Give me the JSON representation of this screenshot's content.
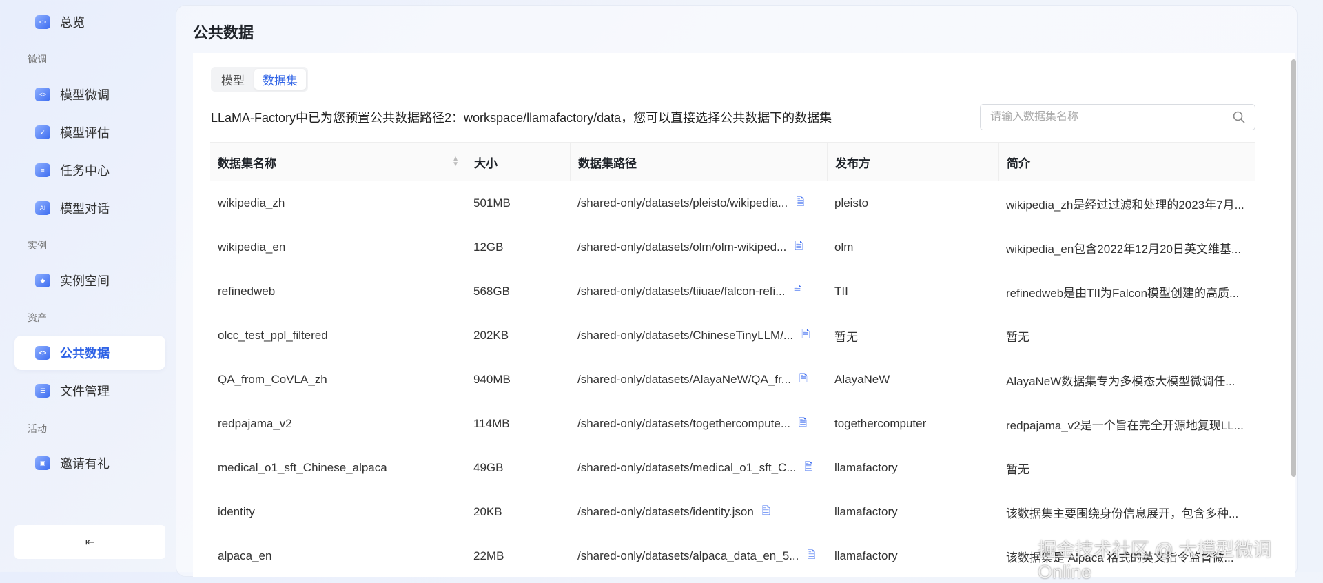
{
  "sidebar": {
    "overview": "总览",
    "sections": [
      "微调",
      "实例",
      "资产",
      "活动"
    ],
    "items": [
      {
        "label": "模型微调"
      },
      {
        "label": "模型评估"
      },
      {
        "label": "任务中心"
      },
      {
        "label": "模型对话"
      },
      {
        "label": "实例空间"
      },
      {
        "label": "公共数据"
      },
      {
        "label": "文件管理"
      },
      {
        "label": "邀请有礼"
      }
    ],
    "collapse_icon": "⇤"
  },
  "page": {
    "title": "公共数据",
    "tabs": [
      {
        "label": "模型"
      },
      {
        "label": "数据集"
      }
    ],
    "description": "LLaMA-Factory中已为您预置公共数据路径2：workspace/llamafactory/data，您可以直接选择公共数据下的数据集",
    "search_placeholder": "请输入数据集名称"
  },
  "table": {
    "headers": [
      "数据集名称",
      "大小",
      "数据集路径",
      "发布方",
      "简介"
    ],
    "rows": [
      {
        "name": "wikipedia_zh",
        "size": "501MB",
        "path": "/shared-only/datasets/pleisto/wikipedia...",
        "publisher": "pleisto",
        "intro": "wikipedia_zh是经过过滤和处理的2023年7月..."
      },
      {
        "name": "wikipedia_en",
        "size": "12GB",
        "path": "/shared-only/datasets/olm/olm-wikiped...",
        "publisher": "olm",
        "intro": "wikipedia_en包含2022年12月20日英文维基..."
      },
      {
        "name": "refinedweb",
        "size": "568GB",
        "path": "/shared-only/datasets/tiiuae/falcon-refi...",
        "publisher": "TII",
        "intro": "refinedweb是由TII为Falcon模型创建的高质..."
      },
      {
        "name": "olcc_test_ppl_filtered",
        "size": "202KB",
        "path": "/shared-only/datasets/ChineseTinyLLM/...",
        "publisher": "暂无",
        "intro": "暂无"
      },
      {
        "name": "QA_from_CoVLA_zh",
        "size": "940MB",
        "path": "/shared-only/datasets/AlayaNeW/QA_fr...",
        "publisher": "AlayaNeW",
        "intro": "AlayaNeW数据集专为多模态大模型微调任..."
      },
      {
        "name": "redpajama_v2",
        "size": "114MB",
        "path": "/shared-only/datasets/togethercompute...",
        "publisher": "togethercomputer",
        "intro": "redpajama_v2是一个旨在完全开源地复现LL..."
      },
      {
        "name": "medical_o1_sft_Chinese_alpaca",
        "size": "49GB",
        "path": "/shared-only/datasets/medical_o1_sft_C...",
        "publisher": "llamafactory",
        "intro": "暂无"
      },
      {
        "name": "identity",
        "size": "20KB",
        "path": "/shared-only/datasets/identity.json",
        "publisher": "llamafactory",
        "intro": "该数据集主要围绕身份信息展开，包含多种..."
      },
      {
        "name": "alpaca_en",
        "size": "22MB",
        "path": "/shared-only/datasets/alpaca_data_en_5...",
        "publisher": "llamafactory",
        "intro": "该数据集是 Alpaca 格式的英文指令监督微..."
      }
    ]
  },
  "watermark": "掘金技术社区 @ 大模型微调Online",
  "colors": {
    "accent": "#2f63e6"
  }
}
